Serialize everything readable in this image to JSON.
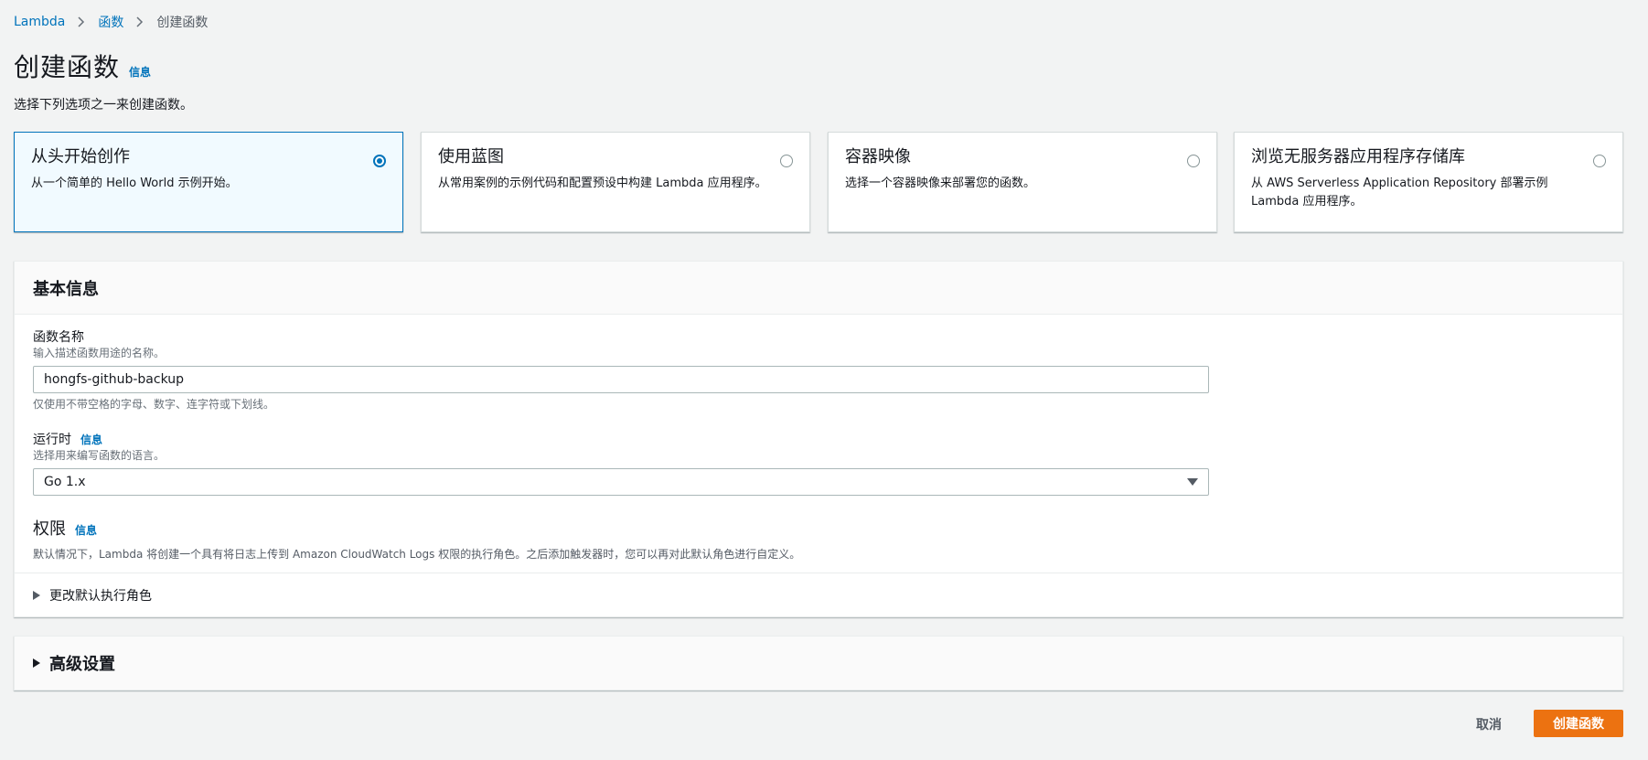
{
  "breadcrumb": {
    "items": [
      "Lambda",
      "函数"
    ],
    "current": "创建函数"
  },
  "header": {
    "title": "创建函数",
    "info": "信息",
    "description": "选择下列选项之一来创建函数。"
  },
  "options": [
    {
      "title": "从头开始创作",
      "description": "从一个简单的 Hello World 示例开始。",
      "selected": true
    },
    {
      "title": "使用蓝图",
      "description": "从常用案例的示例代码和配置预设中构建 Lambda 应用程序。",
      "selected": false
    },
    {
      "title": "容器映像",
      "description": "选择一个容器映像来部署您的函数。",
      "selected": false
    },
    {
      "title": "浏览无服务器应用程序存储库",
      "description": "从 AWS Serverless Application Repository 部署示例 Lambda 应用程序。",
      "selected": false
    }
  ],
  "basic": {
    "title": "基本信息",
    "name_label": "函数名称",
    "name_desc": "输入描述函数用途的名称。",
    "name_value": "hongfs-github-backup",
    "name_constraint": "仅使用不带空格的字母、数字、连字符或下划线。",
    "runtime_label": "运行时",
    "runtime_info": "信息",
    "runtime_desc": "选择用来编写函数的语言。",
    "runtime_value": "Go 1.x",
    "perm_title": "权限",
    "perm_info": "信息",
    "perm_desc": "默认情况下，Lambda 将创建一个具有将日志上传到 Amazon CloudWatch Logs 权限的执行角色。之后添加触发器时，您可以再对此默认角色进行自定义。",
    "change_role": "更改默认执行角色"
  },
  "advanced": {
    "title": "高级设置"
  },
  "actions": {
    "cancel": "取消",
    "create": "创建函数"
  },
  "colors": {
    "link": "#0073bb",
    "primary_button": "#ec7211",
    "selected_bg": "#f1faff"
  }
}
